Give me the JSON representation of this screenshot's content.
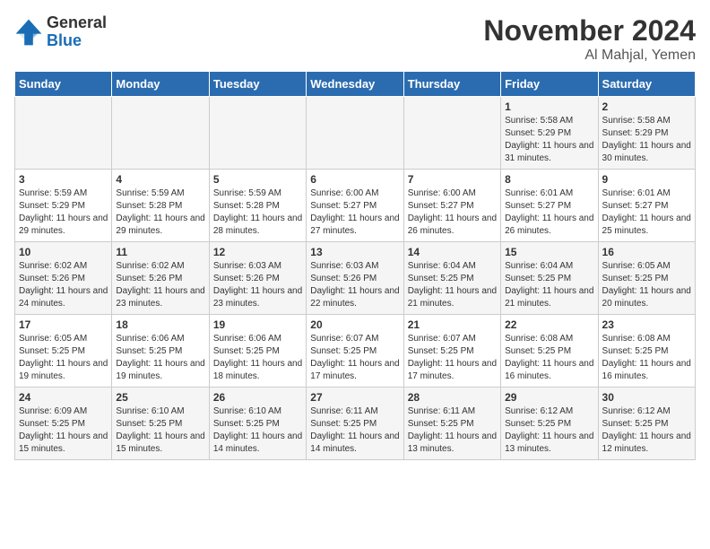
{
  "header": {
    "logo_general": "General",
    "logo_blue": "Blue",
    "month_title": "November 2024",
    "location": "Al Mahjal, Yemen"
  },
  "days_of_week": [
    "Sunday",
    "Monday",
    "Tuesday",
    "Wednesday",
    "Thursday",
    "Friday",
    "Saturday"
  ],
  "weeks": [
    [
      {
        "day": "",
        "info": ""
      },
      {
        "day": "",
        "info": ""
      },
      {
        "day": "",
        "info": ""
      },
      {
        "day": "",
        "info": ""
      },
      {
        "day": "",
        "info": ""
      },
      {
        "day": "1",
        "info": "Sunrise: 5:58 AM\nSunset: 5:29 PM\nDaylight: 11 hours and 31 minutes."
      },
      {
        "day": "2",
        "info": "Sunrise: 5:58 AM\nSunset: 5:29 PM\nDaylight: 11 hours and 30 minutes."
      }
    ],
    [
      {
        "day": "3",
        "info": "Sunrise: 5:59 AM\nSunset: 5:29 PM\nDaylight: 11 hours and 29 minutes."
      },
      {
        "day": "4",
        "info": "Sunrise: 5:59 AM\nSunset: 5:28 PM\nDaylight: 11 hours and 29 minutes."
      },
      {
        "day": "5",
        "info": "Sunrise: 5:59 AM\nSunset: 5:28 PM\nDaylight: 11 hours and 28 minutes."
      },
      {
        "day": "6",
        "info": "Sunrise: 6:00 AM\nSunset: 5:27 PM\nDaylight: 11 hours and 27 minutes."
      },
      {
        "day": "7",
        "info": "Sunrise: 6:00 AM\nSunset: 5:27 PM\nDaylight: 11 hours and 26 minutes."
      },
      {
        "day": "8",
        "info": "Sunrise: 6:01 AM\nSunset: 5:27 PM\nDaylight: 11 hours and 26 minutes."
      },
      {
        "day": "9",
        "info": "Sunrise: 6:01 AM\nSunset: 5:27 PM\nDaylight: 11 hours and 25 minutes."
      }
    ],
    [
      {
        "day": "10",
        "info": "Sunrise: 6:02 AM\nSunset: 5:26 PM\nDaylight: 11 hours and 24 minutes."
      },
      {
        "day": "11",
        "info": "Sunrise: 6:02 AM\nSunset: 5:26 PM\nDaylight: 11 hours and 23 minutes."
      },
      {
        "day": "12",
        "info": "Sunrise: 6:03 AM\nSunset: 5:26 PM\nDaylight: 11 hours and 23 minutes."
      },
      {
        "day": "13",
        "info": "Sunrise: 6:03 AM\nSunset: 5:26 PM\nDaylight: 11 hours and 22 minutes."
      },
      {
        "day": "14",
        "info": "Sunrise: 6:04 AM\nSunset: 5:25 PM\nDaylight: 11 hours and 21 minutes."
      },
      {
        "day": "15",
        "info": "Sunrise: 6:04 AM\nSunset: 5:25 PM\nDaylight: 11 hours and 21 minutes."
      },
      {
        "day": "16",
        "info": "Sunrise: 6:05 AM\nSunset: 5:25 PM\nDaylight: 11 hours and 20 minutes."
      }
    ],
    [
      {
        "day": "17",
        "info": "Sunrise: 6:05 AM\nSunset: 5:25 PM\nDaylight: 11 hours and 19 minutes."
      },
      {
        "day": "18",
        "info": "Sunrise: 6:06 AM\nSunset: 5:25 PM\nDaylight: 11 hours and 19 minutes."
      },
      {
        "day": "19",
        "info": "Sunrise: 6:06 AM\nSunset: 5:25 PM\nDaylight: 11 hours and 18 minutes."
      },
      {
        "day": "20",
        "info": "Sunrise: 6:07 AM\nSunset: 5:25 PM\nDaylight: 11 hours and 17 minutes."
      },
      {
        "day": "21",
        "info": "Sunrise: 6:07 AM\nSunset: 5:25 PM\nDaylight: 11 hours and 17 minutes."
      },
      {
        "day": "22",
        "info": "Sunrise: 6:08 AM\nSunset: 5:25 PM\nDaylight: 11 hours and 16 minutes."
      },
      {
        "day": "23",
        "info": "Sunrise: 6:08 AM\nSunset: 5:25 PM\nDaylight: 11 hours and 16 minutes."
      }
    ],
    [
      {
        "day": "24",
        "info": "Sunrise: 6:09 AM\nSunset: 5:25 PM\nDaylight: 11 hours and 15 minutes."
      },
      {
        "day": "25",
        "info": "Sunrise: 6:10 AM\nSunset: 5:25 PM\nDaylight: 11 hours and 15 minutes."
      },
      {
        "day": "26",
        "info": "Sunrise: 6:10 AM\nSunset: 5:25 PM\nDaylight: 11 hours and 14 minutes."
      },
      {
        "day": "27",
        "info": "Sunrise: 6:11 AM\nSunset: 5:25 PM\nDaylight: 11 hours and 14 minutes."
      },
      {
        "day": "28",
        "info": "Sunrise: 6:11 AM\nSunset: 5:25 PM\nDaylight: 11 hours and 13 minutes."
      },
      {
        "day": "29",
        "info": "Sunrise: 6:12 AM\nSunset: 5:25 PM\nDaylight: 11 hours and 13 minutes."
      },
      {
        "day": "30",
        "info": "Sunrise: 6:12 AM\nSunset: 5:25 PM\nDaylight: 11 hours and 12 minutes."
      }
    ]
  ]
}
